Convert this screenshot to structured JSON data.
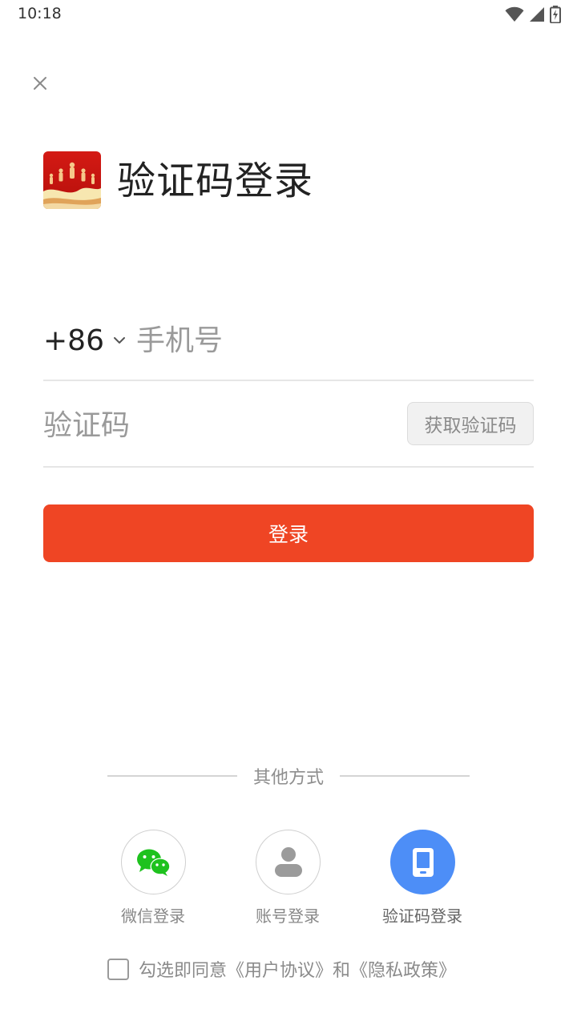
{
  "status_bar": {
    "time": "10:18",
    "icons": [
      "wifi-icon",
      "signal-icon",
      "battery-icon"
    ]
  },
  "header": {
    "close_icon": "close-icon",
    "logo": "app-logo-image",
    "title": "验证码登录"
  },
  "form": {
    "country_code": "+86",
    "phone_placeholder": "手机号",
    "phone_value": "",
    "code_placeholder": "验证码",
    "code_value": "",
    "get_code_label": "获取验证码",
    "login_label": "登录"
  },
  "other_methods": {
    "title": "其他方式",
    "options": [
      {
        "label": "微信登录",
        "icon": "wechat-icon",
        "active": false
      },
      {
        "label": "账号登录",
        "icon": "user-icon",
        "active": false
      },
      {
        "label": "验证码登录",
        "icon": "phone-icon",
        "active": true
      }
    ]
  },
  "agreement": {
    "checked": false,
    "prefix": "勾选即同意",
    "user_agreement": "《用户协议》",
    "conjunction": "和",
    "privacy_policy": "《隐私政策》"
  },
  "colors": {
    "primary": "#ef4524",
    "active_option": "#4d8ef7",
    "wechat_green": "#1ec21e"
  }
}
